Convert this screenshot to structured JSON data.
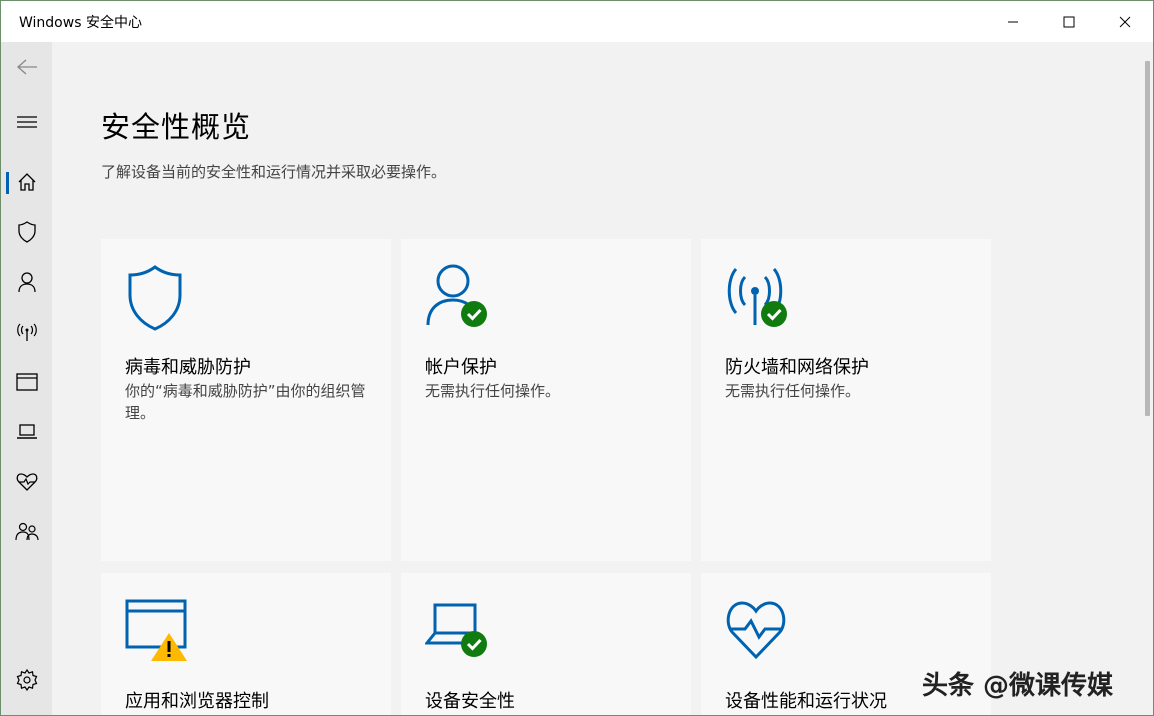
{
  "window": {
    "title": "Windows 安全中心"
  },
  "titlebar_buttons": {
    "minimize": "minimize-icon",
    "maximize": "maximize-icon",
    "close": "close-icon"
  },
  "sidebar": {
    "items": [
      {
        "name": "back",
        "icon": "back-arrow-icon"
      },
      {
        "name": "menu",
        "icon": "hamburger-menu-icon"
      },
      {
        "name": "home",
        "icon": "home-icon",
        "selected": true
      },
      {
        "name": "virus-protection",
        "icon": "shield-icon"
      },
      {
        "name": "account-protection",
        "icon": "person-icon"
      },
      {
        "name": "firewall",
        "icon": "antenna-icon"
      },
      {
        "name": "app-browser",
        "icon": "browser-window-icon"
      },
      {
        "name": "device-security",
        "icon": "laptop-icon"
      },
      {
        "name": "device-performance",
        "icon": "heart-pulse-icon"
      },
      {
        "name": "family-options",
        "icon": "family-icon"
      },
      {
        "name": "settings",
        "icon": "gear-icon"
      }
    ]
  },
  "main": {
    "title": "安全性概览",
    "subtitle": "了解设备当前的安全性和运行情况并采取必要操作。",
    "cards": [
      {
        "title": "病毒和威胁防护",
        "description": "你的“病毒和威胁防护”由你的组织管理。",
        "icon": "shield-icon"
      },
      {
        "title": "帐户保护",
        "description": "无需执行任何操作。",
        "icon": "person-check-icon"
      },
      {
        "title": "防火墙和网络保护",
        "description": "无需执行任何操作。",
        "icon": "antenna-check-icon"
      },
      {
        "title": "应用和浏览器控制",
        "description": "",
        "icon": "browser-warning-icon"
      },
      {
        "title": "设备安全性",
        "description": "",
        "icon": "laptop-check-icon"
      },
      {
        "title": "设备性能和运行状况",
        "description": "",
        "icon": "heart-pulse-icon"
      }
    ]
  },
  "watermark": "头条 @微课传媒",
  "colors": {
    "accent": "#0063b1",
    "success": "#107c10",
    "warning": "#ffb900"
  }
}
